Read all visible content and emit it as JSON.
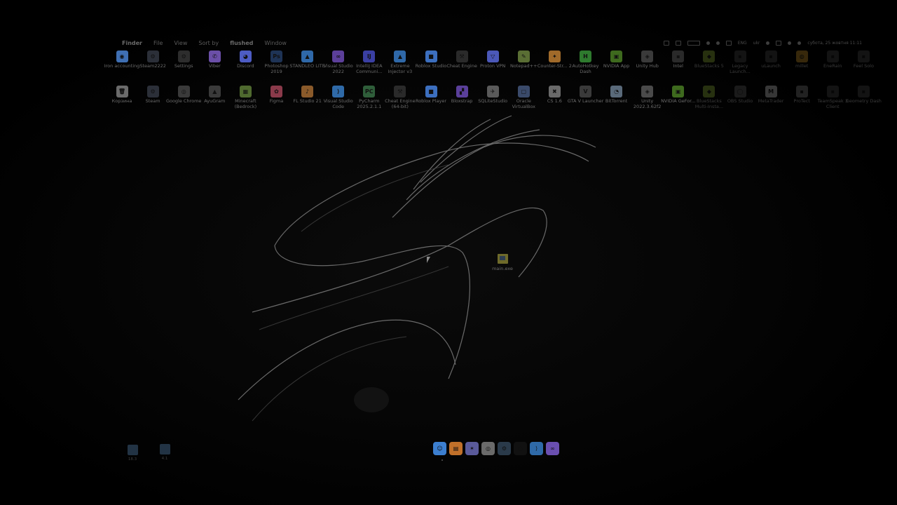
{
  "menubar": {
    "items": [
      "Finder",
      "File",
      "View",
      "Sort by",
      "flushed",
      "Window"
    ],
    "status_text": [
      "ENG",
      "ukr",
      "субота, 25 жовтня 11:11"
    ]
  },
  "desktop_row1": [
    {
      "label": "Iron accounting",
      "color": "#3f6fb3",
      "glyph": "◉"
    },
    {
      "label": "Steam2222",
      "color": "#2b2f38",
      "glyph": "⚙"
    },
    {
      "label": "Settings",
      "color": "#2d2d2d",
      "glyph": "⚙"
    },
    {
      "label": "Viber",
      "color": "#6b4fa8",
      "glyph": "✆"
    },
    {
      "label": "Discord",
      "color": "#4d5cc4",
      "glyph": "◕"
    },
    {
      "label": "Photoshop 2019",
      "color": "#1e3355",
      "glyph": "Ps"
    },
    {
      "label": "STANDLEO LITE",
      "color": "#2f68a8",
      "glyph": "▲"
    },
    {
      "label": "Visual Studio 2022",
      "color": "#5c3f9a",
      "glyph": "∞"
    },
    {
      "label": "IntelliJ IDEA Communi...",
      "color": "#3a3fa3",
      "glyph": "IJ"
    },
    {
      "label": "Extreme Injector v3",
      "color": "#2f68a8",
      "glyph": "▲"
    },
    {
      "label": "Roblox Studio",
      "color": "#3c6fbf",
      "glyph": "■"
    },
    {
      "label": "Cheat Engine",
      "color": "#2a2a2a",
      "glyph": "⚒"
    },
    {
      "label": "Proton VPN",
      "color": "#4b58b8",
      "glyph": "▽"
    },
    {
      "label": "Notepad++",
      "color": "#5a6e34",
      "glyph": "✎"
    },
    {
      "label": "Counter-Str... 2",
      "color": "#a06a2a",
      "glyph": "✦"
    },
    {
      "label": "AutoHotkey Dash",
      "color": "#2e7a2e",
      "glyph": "H"
    },
    {
      "label": "NVIDIA App",
      "color": "#3e6a1e",
      "glyph": "▣"
    },
    {
      "label": "Unity Hub",
      "color": "#3a3a3a",
      "glyph": "◈"
    },
    {
      "label": "Intel",
      "color": "#2a2a2a",
      "glyph": "▪"
    },
    {
      "label": "BlueStacks 5",
      "color": "#556a22",
      "glyph": "◆"
    },
    {
      "label": "Legacy Launch...",
      "color": "#2a2a2a",
      "glyph": "▪"
    },
    {
      "label": "uLaunch",
      "color": "#2a2a2a",
      "glyph": "▪"
    },
    {
      "label": "millet",
      "color": "#7a5a1a",
      "glyph": "◍"
    },
    {
      "label": "EneRain",
      "color": "#2a2a2a",
      "glyph": "▪"
    },
    {
      "label": "Feel Solo",
      "color": "#2a2a2a",
      "glyph": "▪"
    }
  ],
  "desktop_row2": [
    {
      "label": "Корзина",
      "color": "#6b6b6b",
      "glyph": "🗑"
    },
    {
      "label": "Steam",
      "color": "#2b2f38",
      "glyph": "⚙"
    },
    {
      "label": "Google Chrome",
      "color": "#3a3a3a",
      "glyph": "◎"
    },
    {
      "label": "AyuGram",
      "color": "#3a3a3a",
      "glyph": "▲"
    },
    {
      "label": "Minecraft (Bedrock)",
      "color": "#4f6a2f",
      "glyph": "▦"
    },
    {
      "label": "Figma",
      "color": "#8a3a4a",
      "glyph": "✿"
    },
    {
      "label": "FL Studio 21",
      "color": "#8a5a2a",
      "glyph": "♪"
    },
    {
      "label": "Visual Studio Code",
      "color": "#2f6aa8",
      "glyph": "⟩"
    },
    {
      "label": "PyCharm 2025.2.1.1",
      "color": "#2f5e3a",
      "glyph": "PC"
    },
    {
      "label": "Cheat Engine (64-bit)",
      "color": "#2a2a2a",
      "glyph": "⚒"
    },
    {
      "label": "Roblox Player",
      "color": "#3c6fbf",
      "glyph": "■"
    },
    {
      "label": "Bloxstrap",
      "color": "#5a3f9a",
      "glyph": "▞"
    },
    {
      "label": "SQLiteStudio",
      "color": "#5a5a5a",
      "glyph": "✈"
    },
    {
      "label": "Oracle VirtualBox",
      "color": "#3a4a6a",
      "glyph": "▢"
    },
    {
      "label": "CS 1.6",
      "color": "#6a6a6a",
      "glyph": "✖"
    },
    {
      "label": "GTA V Launcher",
      "color": "#3a3a3a",
      "glyph": "V"
    },
    {
      "label": "BitTorrent",
      "color": "#5a6a7a",
      "glyph": "◔"
    },
    {
      "label": "Unity 2022.3.62f2",
      "color": "#4a4a4a",
      "glyph": "◈"
    },
    {
      "label": "NVIDIA GeFor...",
      "color": "#3e6a1e",
      "glyph": "▣"
    },
    {
      "label": "BlueStacks Multi-Insta...",
      "color": "#556a22",
      "glyph": "◆"
    },
    {
      "label": "OBS Studio",
      "color": "#3a3a3a",
      "glyph": "◯"
    },
    {
      "label": "MetaTrader",
      "color": "#7a7a7a",
      "glyph": "M"
    },
    {
      "label": "ProTect",
      "color": "#4a4a4a",
      "glyph": "▪"
    },
    {
      "label": "TeamSpeak 3 Client",
      "color": "#2a2a2a",
      "glyph": "▪"
    },
    {
      "label": "Geometry Dash",
      "color": "#2a2a2a",
      "glyph": "▪"
    }
  ],
  "desktop_file": {
    "label": "main.exe"
  },
  "bottom_left": [
    {
      "label": "18.3"
    },
    {
      "label": "4.1"
    }
  ],
  "dock": [
    {
      "name": "finder",
      "color": "#3c7fd0",
      "glyph": "☺"
    },
    {
      "name": "app-2",
      "color": "#c0702a",
      "glyph": "▤"
    },
    {
      "name": "app-3",
      "color": "#5a5a9a",
      "glyph": "✶"
    },
    {
      "name": "chrome",
      "color": "#6a6a6a",
      "glyph": "◎"
    },
    {
      "name": "steam",
      "color": "#2a3a4a",
      "glyph": "⚙"
    },
    {
      "name": "app-6",
      "color": "#111111",
      "glyph": "●"
    },
    {
      "name": "vscode",
      "color": "#2f6aa8",
      "glyph": "⟩"
    },
    {
      "name": "visual-studio",
      "color": "#6a4fb0",
      "glyph": "∞"
    }
  ]
}
